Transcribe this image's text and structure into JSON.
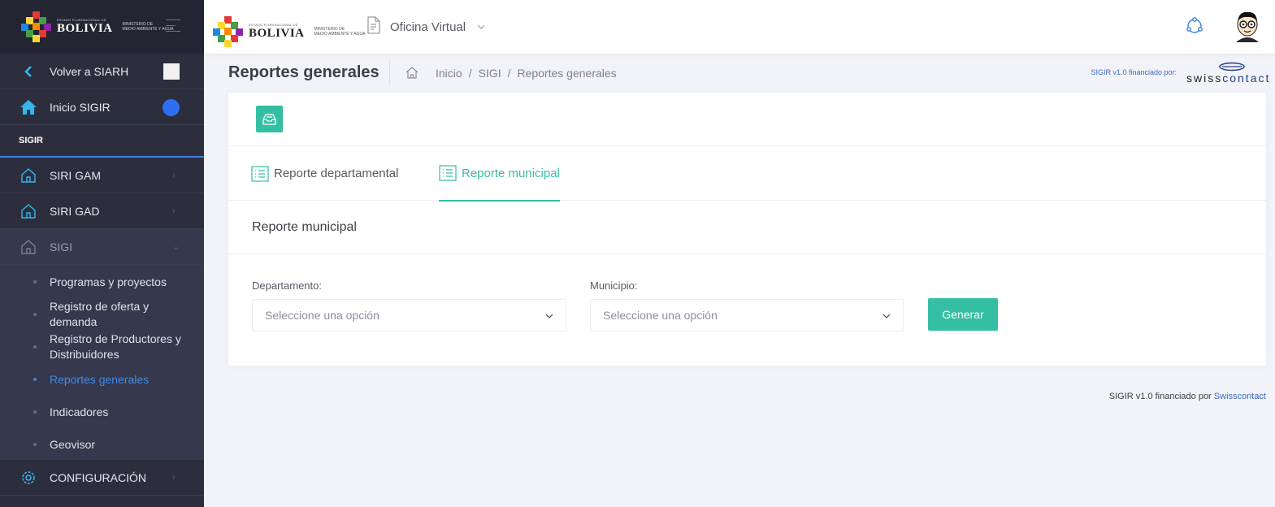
{
  "brand": {
    "small_text": "ESTADO PLURINACIONAL DE",
    "name": "BOLIVIA",
    "ministry_line1": "MINISTERIO DE",
    "ministry_line2": "MEDIO AMBIENTE Y AGUA"
  },
  "header": {
    "app_label": "Oficina Virtual"
  },
  "sidebar": {
    "back": "Volver a SIARH",
    "home": "Inicio SIGIR",
    "section": "SIGIR",
    "items": [
      {
        "label": "SIRI GAM"
      },
      {
        "label": "SIRI GAD"
      },
      {
        "label": "SIGI"
      }
    ],
    "submenu": [
      {
        "label": "Programas y proyectos"
      },
      {
        "label": "Registro de oferta y demanda"
      },
      {
        "label": "Registro de Productores y Distribuidores"
      },
      {
        "label": "Reportes generales"
      },
      {
        "label": "Indicadores"
      },
      {
        "label": "Geovisor"
      }
    ],
    "config": "CONFIGURACIÓN"
  },
  "subheader": {
    "title": "Reportes generales",
    "breadcrumb": [
      "Inicio",
      "/",
      "SIGI",
      "/",
      "Reportes generales"
    ],
    "funder_text": "SIGIR v1.0 financiado por:",
    "funder_logo": "swisscontact",
    "funder_logo_a": "swiss",
    "funder_logo_b": "contact"
  },
  "card": {
    "tabs": [
      {
        "label": "Reporte departamental"
      },
      {
        "label": "Reporte municipal"
      }
    ],
    "section_title": "Reporte municipal",
    "fields": {
      "departamento_label": "Departamento:",
      "departamento_placeholder": "Seleccione una opción",
      "municipio_label": "Municipio:",
      "municipio_placeholder": "Seleccione una opción"
    },
    "generate_button": "Generar"
  },
  "footer": {
    "text": "SIGIR v1.0 financiado por",
    "link": "Swisscontact"
  },
  "colors": {
    "accent": "#34bfa3",
    "sidebar_bg": "#2c2e3e",
    "active_link": "#3f8ae6",
    "link": "#3c67c5"
  }
}
